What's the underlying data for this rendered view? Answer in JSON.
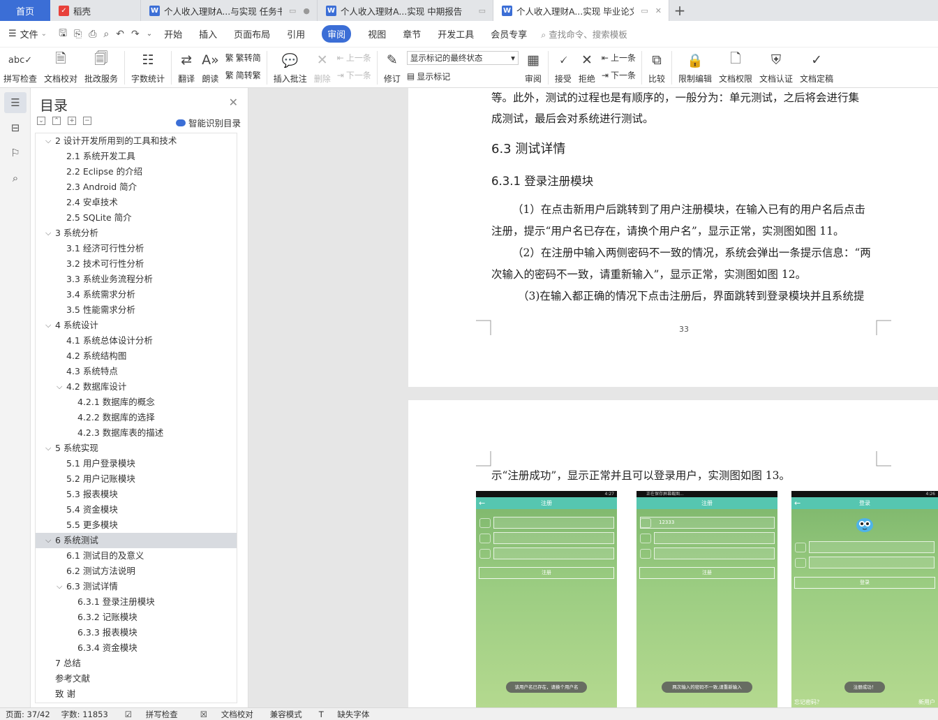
{
  "tabs": {
    "home": "首页",
    "items": [
      {
        "label": "稻壳",
        "icon": "docer-icon"
      },
      {
        "label": "个人收入理财A...与实现 任务书",
        "icon": "word-doc-icon"
      },
      {
        "label": "个人收入理财A...实现 中期报告",
        "icon": "word-doc-icon"
      },
      {
        "label": "个人收入理财A...实现 毕业论文",
        "icon": "word-doc-icon"
      }
    ],
    "add": "+"
  },
  "menu": {
    "file": "文件",
    "items": [
      "开始",
      "插入",
      "页面布局",
      "引用",
      "审阅",
      "视图",
      "章节",
      "开发工具",
      "会员专享"
    ],
    "active": "审阅",
    "search": "查找命令、搜索模板"
  },
  "ribbon": {
    "spell": "拼写检查",
    "proof": "文档校对",
    "batch": "批改服务",
    "wordcount": "字数统计",
    "translate": "翻译",
    "read": "朗读",
    "trad": "繁转简",
    "simp": "简转繁",
    "insert_comment": "插入批注",
    "delete": "删除",
    "prev": "上一条",
    "next": "下一条",
    "revise": "修订",
    "markup_state": "显示标记的最终状态",
    "show_markup": "显示标记",
    "review": "审阅",
    "accept": "接受",
    "reject": "拒绝",
    "prev2": "上一条",
    "next2": "下一条",
    "compare": "比较",
    "restrict": "限制编辑",
    "permission": "文档权限",
    "certify": "文档认证",
    "final": "文档定稿"
  },
  "toc": {
    "title": "目录",
    "smart": "智能识别目录",
    "items": [
      {
        "text": "2 设计开发所用到的工具和技术",
        "level": 1,
        "caret": true
      },
      {
        "text": "2.1 系统开发工具",
        "level": 2
      },
      {
        "text": "2.2 Eclipse 的介绍",
        "level": 2
      },
      {
        "text": "2.3 Android 简介",
        "level": 2
      },
      {
        "text": "2.4 安卓技术",
        "level": 2
      },
      {
        "text": "2.5 SQLite 简介",
        "level": 2
      },
      {
        "text": "3 系统分析",
        "level": 1,
        "caret": true
      },
      {
        "text": "3.1  经济可行性分析",
        "level": 2
      },
      {
        "text": "3.2  技术可行性分析",
        "level": 2
      },
      {
        "text": "3.3  系统业务流程分析",
        "level": 2
      },
      {
        "text": "3.4  系统需求分析",
        "level": 2
      },
      {
        "text": "3.5  性能需求分析",
        "level": 2
      },
      {
        "text": "4 系统设计",
        "level": 1,
        "caret": true
      },
      {
        "text": "4.1 系统总体设计分析",
        "level": 2
      },
      {
        "text": "4.2 系统结构图",
        "level": 2
      },
      {
        "text": "4.3 系统特点",
        "level": 2
      },
      {
        "text": "4.2 数据库设计",
        "level": 2,
        "caret": true
      },
      {
        "text": "4.2.1 数据库的概念",
        "level": 3
      },
      {
        "text": "4.2.2 数据库的选择",
        "level": 3
      },
      {
        "text": "4.2.3 数据库表的描述",
        "level": 3
      },
      {
        "text": "5 系统实现",
        "level": 1,
        "caret": true
      },
      {
        "text": "5.1 用户登录模块",
        "level": 2
      },
      {
        "text": "5.2 用户记账模块",
        "level": 2
      },
      {
        "text": "5.3 报表模块",
        "level": 2
      },
      {
        "text": "5.4 资金模块",
        "level": 2
      },
      {
        "text": "5.5 更多模块",
        "level": 2
      },
      {
        "text": "6 系统测试",
        "level": 1,
        "caret": true,
        "selected": true
      },
      {
        "text": "6.1 测试目的及意义",
        "level": 2
      },
      {
        "text": "6.2 测试方法说明",
        "level": 2
      },
      {
        "text": "6.3 测试详情",
        "level": 2,
        "caret": true
      },
      {
        "text": "6.3.1  登录注册模块",
        "level": 3
      },
      {
        "text": "6.3.2  记账模块",
        "level": 3
      },
      {
        "text": "6.3.3  报表模块",
        "level": 3
      },
      {
        "text": "6.3.4  资金模块",
        "level": 3
      },
      {
        "text": "7 总结",
        "level": 1
      },
      {
        "text": "参考文献",
        "level": 1
      },
      {
        "text": "致    谢",
        "level": 1
      }
    ]
  },
  "doc": {
    "p1_line1": "等。此外，测试的过程也是有顺序的，一般分为：单元测试，之后将会进行集",
    "p1_line2": "成测试，最后会对系统进行测试。",
    "h2": "6.3 测试详情",
    "h3": "6.3.1  登录注册模块",
    "para1_line1": "（1）在点击新用户后跳转到了用户注册模块，在输入已有的用户名后点击",
    "para1_line2": "注册，提示“用户名已存在，请换个用户名”，显示正常，实测图如图 11。",
    "para2_line1": "（2）在注册中输入两侧密码不一致的情况，系统会弹出一条提示信息：“两",
    "para2_line2": "次输入的密码不一致，请重新输入”，显示正常，实测图如图 12。",
    "para3_line1": "（3)在输入都正确的情况下点击注册后，界面跳转到登录模块并且系统提",
    "page_number": "33",
    "p2_line1": "示“注册成功”，显示正常并且可以登录用户，实测图如图 13。"
  },
  "phones": [
    {
      "title": "注册",
      "time": "4:27",
      "field1": "",
      "button": "注册",
      "toast": "该用户名已存在，请换个用户名"
    },
    {
      "title": "注册",
      "status_left": "正在保存屏幕截图...",
      "field1": "12333",
      "button": "注册",
      "toast": "两次输入的密码不一致,请重新输入"
    },
    {
      "title": "登录",
      "time": "4:26",
      "button": "登录",
      "toast": "注册成功！",
      "foot_left": "忘记密码？",
      "foot_right": "新用户"
    }
  ],
  "status": {
    "page": "页面: 37/42",
    "words": "字数: 11853",
    "spell": "拼写检查",
    "proof": "文档校对",
    "compat": "兼容模式",
    "missing_font": "缺失字体"
  },
  "colors": {
    "accent": "#3b6ed6",
    "phone_bar": "#56c6b0"
  }
}
